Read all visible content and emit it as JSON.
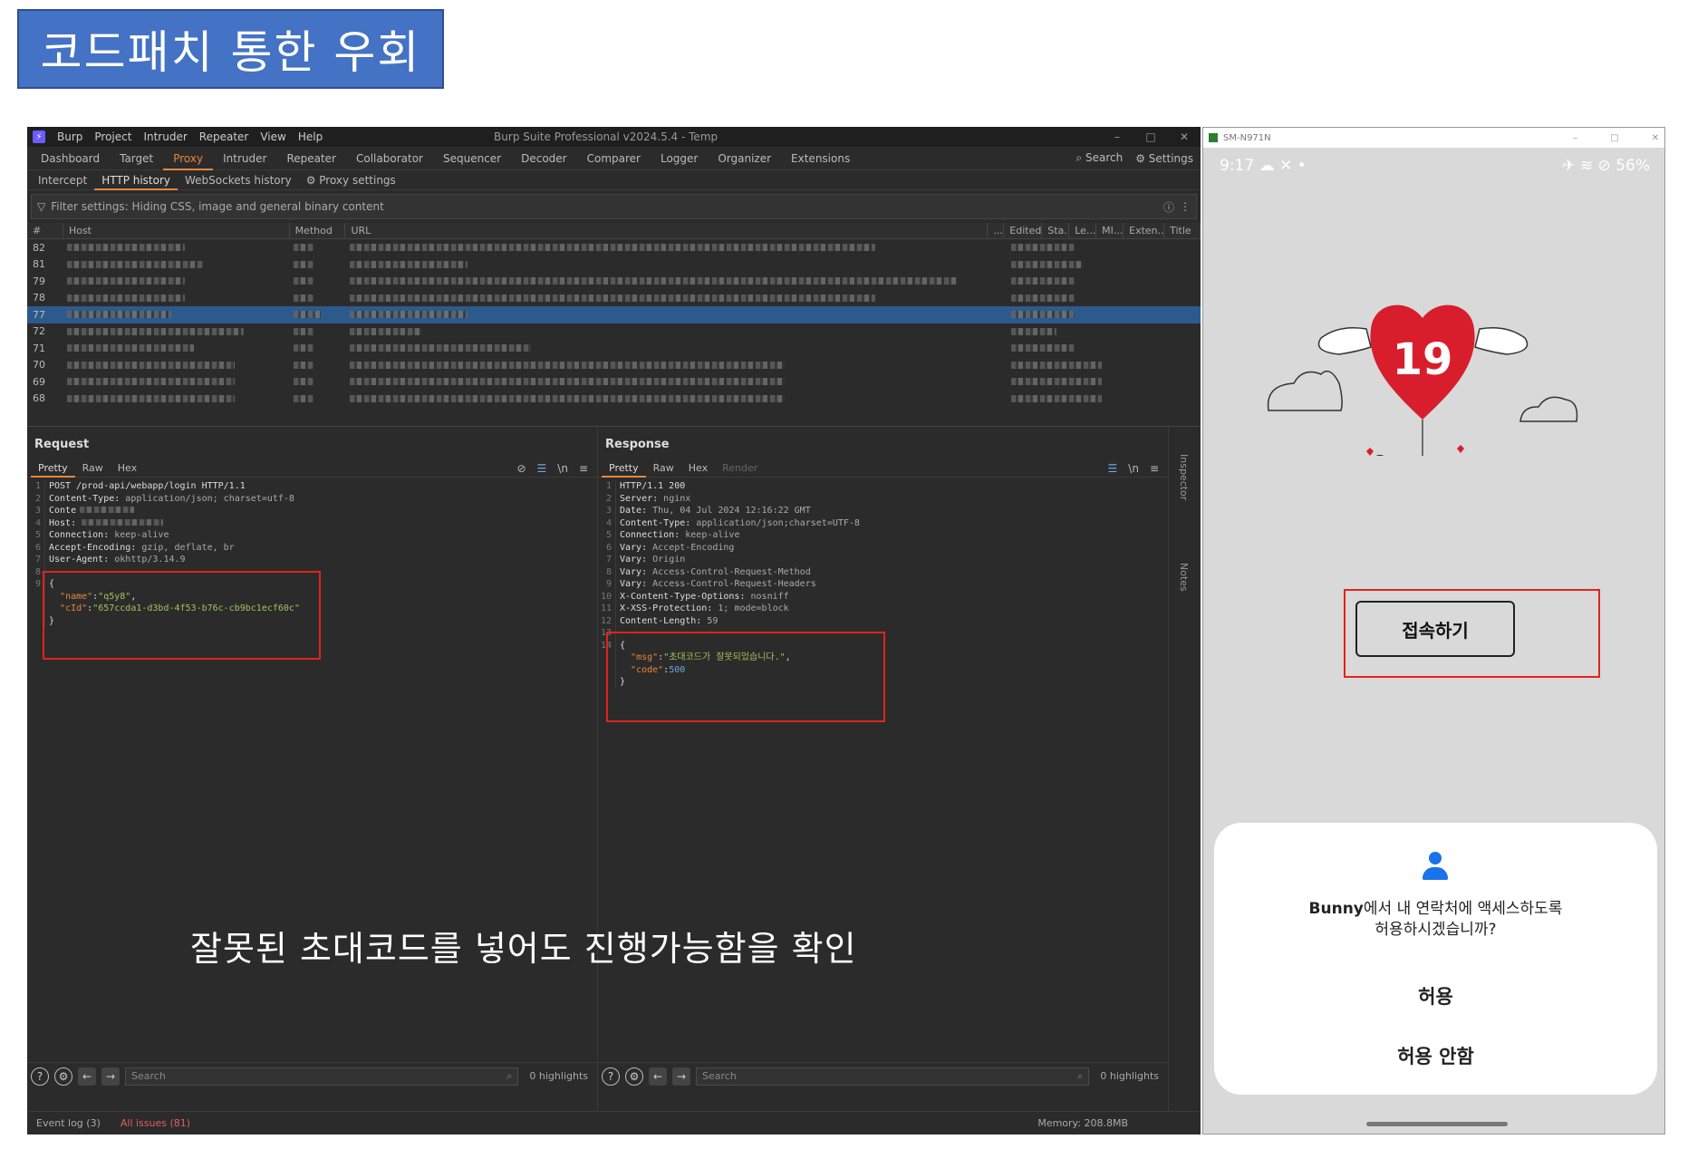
{
  "slide": {
    "title": "코드패치 통한 우회",
    "caption": "잘못된 초대코드를 넣어도 진행가능함을 확인"
  },
  "burp": {
    "menu": [
      "Burp",
      "Project",
      "Intruder",
      "Repeater",
      "View",
      "Help"
    ],
    "window_title": "Burp Suite Professional v2024.5.4 - Temp",
    "main_tabs": [
      "Dashboard",
      "Target",
      "Proxy",
      "Intruder",
      "Repeater",
      "Collaborator",
      "Sequencer",
      "Decoder",
      "Comparer",
      "Logger",
      "Organizer",
      "Extensions"
    ],
    "active_main_tab": "Proxy",
    "search_label": "Search",
    "settings_label": "Settings",
    "proxy_tabs": [
      "Intercept",
      "HTTP history",
      "WebSockets history"
    ],
    "proxy_settings_label": "Proxy settings",
    "filter_text": "Filter settings: Hiding CSS, image and general binary content",
    "columns": [
      "#",
      "Host",
      "Method",
      "URL",
      "...",
      "Edited",
      "Sta...",
      "Le...",
      "MI...",
      "Exten...",
      "Title"
    ],
    "row_numbers": [
      "82",
      "81",
      "79",
      "78",
      "77",
      "72",
      "71",
      "70",
      "69",
      "68"
    ],
    "selected_row": "77",
    "request": {
      "title": "Request",
      "tabs": [
        "Pretty",
        "Raw",
        "Hex"
      ],
      "lines": [
        {
          "n": "1",
          "text": "POST /prod-api/webapp/login HTTP/1.1"
        },
        {
          "n": "2",
          "key": "Content-Type:",
          "text": " application/json; charset=utf-8"
        },
        {
          "n": "3",
          "key": "Conte",
          "text": ""
        },
        {
          "n": "4",
          "key": "Host:",
          "text": ""
        },
        {
          "n": "5",
          "key": "Connection:",
          "text": " keep-alive"
        },
        {
          "n": "6",
          "key": "Accept-Encoding:",
          "text": " gzip, deflate, br"
        },
        {
          "n": "7",
          "key": "User-Agent:",
          "text": " okhttp/3.14.9"
        },
        {
          "n": "8",
          "text": ""
        },
        {
          "n": "9",
          "text": "{"
        },
        {
          "n": "",
          "json_key": "\"name\"",
          "json_val": "\"q5y8\"",
          "tail": ","
        },
        {
          "n": "",
          "json_key": "\"cId\"",
          "json_val": "\"657ccda1-d3bd-4f53-b76c-cb9bc1ecf60c\"",
          "tail": ""
        },
        {
          "n": "",
          "text": "}"
        }
      ],
      "search_placeholder": "Search",
      "highlights": "0 highlights"
    },
    "response": {
      "title": "Response",
      "tabs": [
        "Pretty",
        "Raw",
        "Hex",
        "Render"
      ],
      "lines": [
        {
          "n": "1",
          "text": "HTTP/1.1 200"
        },
        {
          "n": "2",
          "key": "Server:",
          "text": " nginx"
        },
        {
          "n": "3",
          "key": "Date:",
          "text": " Thu, 04 Jul 2024 12:16:22 GMT"
        },
        {
          "n": "4",
          "key": "Content-Type:",
          "text": " application/json;charset=UTF-8"
        },
        {
          "n": "5",
          "key": "Connection:",
          "text": " keep-alive"
        },
        {
          "n": "6",
          "key": "Vary:",
          "text": " Accept-Encoding"
        },
        {
          "n": "7",
          "key": "Vary:",
          "text": " Origin"
        },
        {
          "n": "8",
          "key": "Vary:",
          "text": " Access-Control-Request-Method"
        },
        {
          "n": "9",
          "key": "Vary:",
          "text": " Access-Control-Request-Headers"
        },
        {
          "n": "10",
          "key": "X-Content-Type-Options:",
          "text": " nosniff"
        },
        {
          "n": "11",
          "key": "X-XSS-Protection:",
          "text": " 1; mode=block"
        },
        {
          "n": "12",
          "key": "Content-Length:",
          "text": " 59"
        },
        {
          "n": "13",
          "text": ""
        },
        {
          "n": "14",
          "text": "{"
        },
        {
          "n": "",
          "json_key": "\"msg\"",
          "json_val": "\"초대코드가 잘못되었습니다.\"",
          "tail": ","
        },
        {
          "n": "",
          "json_key": "\"code\"",
          "json_num": "500",
          "tail": ""
        },
        {
          "n": "",
          "text": "}"
        }
      ],
      "search_placeholder": "Search",
      "highlights": "0 highlights"
    },
    "side_labels": [
      "Inspector",
      "Notes"
    ],
    "status": {
      "event_log": "Event log (3)",
      "all_issues": "All issues (81)",
      "memory": "Memory: 208.8MB"
    }
  },
  "phone": {
    "window_title": "SM-N971N",
    "time": "9:17",
    "battery": "56%",
    "badge_number": "19",
    "connect_button": "접속하기",
    "dialog": {
      "app_name": "Bunny",
      "message_rest": "에서 내 연락처에 액세스하도록",
      "message_line2": "허용하시겠습니까?",
      "allow": "허용",
      "deny": "허용 안함"
    }
  }
}
